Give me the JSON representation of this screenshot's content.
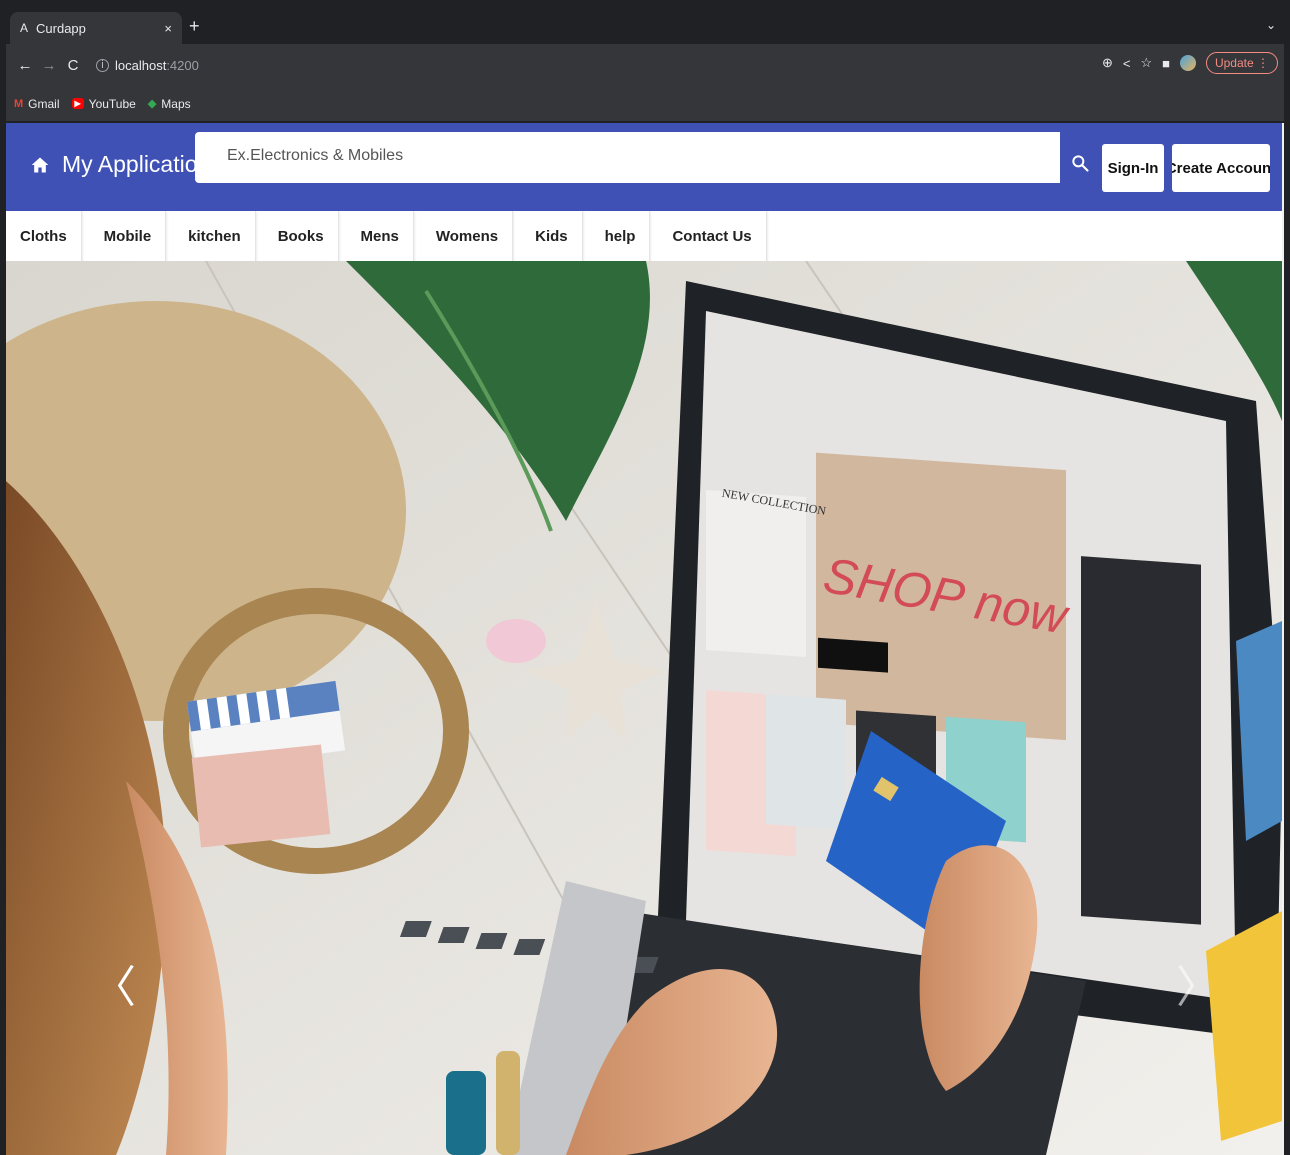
{
  "browser": {
    "tab": {
      "favicon": "A",
      "title": "Curdapp",
      "close": "×"
    },
    "new_tab": "+",
    "tab_menu": "⌄",
    "address": {
      "host": "localhost",
      "port": ":4200"
    },
    "update_label": "Update",
    "bookmarks": [
      {
        "icon": "M",
        "label": "Gmail"
      },
      {
        "icon": "▶",
        "label": "YouTube"
      },
      {
        "icon": "◆",
        "label": "Maps"
      }
    ]
  },
  "app": {
    "brand": "My Application",
    "search_placeholder": "Ex.Electronics & Mobiles",
    "signin_label": "Sign-In",
    "create_label": "Create Account",
    "brand_color": "#3f51b5"
  },
  "menu": {
    "items": [
      {
        "label": "Cloths"
      },
      {
        "label": "Mobile"
      },
      {
        "label": "kitchen"
      },
      {
        "label": "Books"
      },
      {
        "label": "Mens"
      },
      {
        "label": "Womens"
      },
      {
        "label": "Kids"
      },
      {
        "label": "help"
      },
      {
        "label": "Contact Us"
      }
    ]
  },
  "carousel": {
    "prev": "〈",
    "next": "〉",
    "banner": {
      "collection_label": "NEW COLLECTION",
      "shop_text": "SHOP now"
    }
  }
}
